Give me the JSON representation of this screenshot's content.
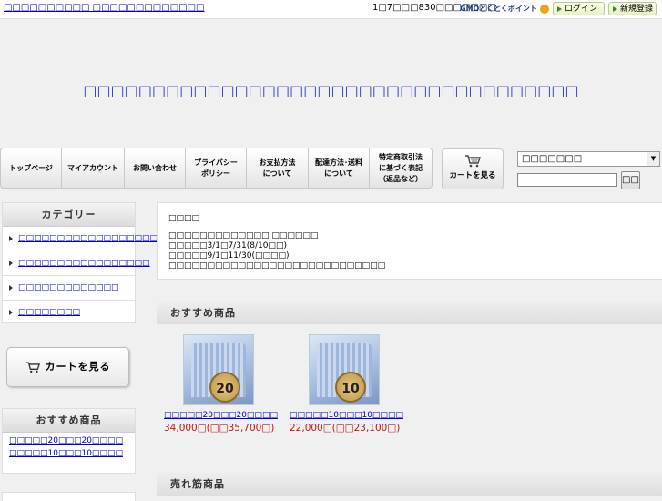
{
  "header": {
    "site_link": "□□□□□□□□□□ □□□□□□□□□□□□□",
    "points_text": "1□7□□□830□□□□□□□",
    "gmo_logo_text": "GMOとくとくポイント",
    "login_label": "ログイン",
    "register_label": "新規登録"
  },
  "site_title": "□□□□□□□□□□□□□□□□□□□□□□□□□□□□□□□□□□□□",
  "nav": {
    "items": [
      {
        "label": "トップページ"
      },
      {
        "label": "マイアカウント"
      },
      {
        "label": "お問い合わせ"
      },
      {
        "label": "プライバシー\nポリシー"
      },
      {
        "label": "お支払方法\nについて"
      },
      {
        "label": "配達方法･送料\nについて"
      },
      {
        "label": "特定商取引法\nに基づく表記\n（返品など）"
      }
    ],
    "cart_label": "カートを見る"
  },
  "search": {
    "select_value": "□□□□□□□",
    "input_value": "",
    "button_label": "□□"
  },
  "sidebar": {
    "category_heading": "カテゴリー",
    "categories": [
      {
        "label": "□□□□□□□□□□□□□□□□□□□"
      },
      {
        "label": "□□□□□□□□□□□□□□□□□"
      },
      {
        "label": "□□□□□□□□□□□□□"
      },
      {
        "label": "□□□□□□□□"
      }
    ],
    "cart_label": "カートを見る",
    "recommend_heading": "おすすめ商品",
    "recommend_items": [
      {
        "label": "□□□□□20□□□20□□□□"
      },
      {
        "label": "□□□□□10□□□10□□□□"
      }
    ]
  },
  "notice": {
    "lines": [
      "□□□□",
      "",
      "□□□□□□□□□□□□□ □□□□□□",
      "□□□□□3/1□7/31(8/10□□)",
      "□□□□□9/1□11/30(□□□□)",
      "□□□□□□□□□□□□□□□□□□□□□□□□□□□□"
    ]
  },
  "main": {
    "recommend_heading": "おすすめ商品",
    "products": [
      {
        "name": "□□□□□20□□□20□□□□",
        "price": "34,000□(□□35,700□)",
        "medal_number": "20",
        "medal_text": "medal"
      },
      {
        "name": "□□□□□10□□□10□□□□",
        "price": "22,000□(□□23,100□)",
        "medal_number": "10",
        "medal_text": "medal"
      }
    ],
    "bestseller_heading": "売れ筋商品"
  },
  "colors": {
    "link": "#0000cc",
    "title": "#2233bb",
    "price": "#cc1111",
    "header_button_bg": "#e7f0c4"
  },
  "icons": {
    "cart": "cart-icon",
    "header_arrow": "arrow-right-icon",
    "category_bullet": "triangle-right-icon"
  }
}
